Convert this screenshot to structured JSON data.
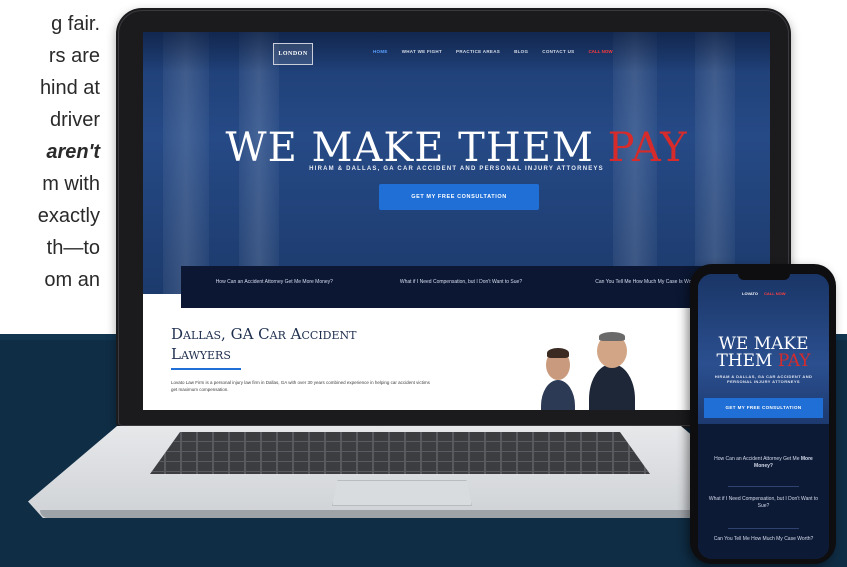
{
  "article": {
    "lines": [
      {
        "text": "g fair.",
        "emphasis": false
      },
      {
        "text": "rs are",
        "emphasis": false
      },
      {
        "text": "hind at",
        "emphasis": false
      },
      {
        "text": "driver",
        "emphasis": false
      },
      {
        "text": "aren't",
        "emphasis": true
      },
      {
        "text": "m with",
        "emphasis": false
      },
      {
        "text": "exactly",
        "emphasis": false
      },
      {
        "text": "th—to",
        "emphasis": false
      },
      {
        "text": "om an",
        "emphasis": false
      }
    ]
  },
  "laptop_site": {
    "logo_text": "LONDON",
    "nav": {
      "items": [
        "HOME",
        "WHAT WE FIGHT",
        "PRACTICE AREAS",
        "BLOG",
        "CONTACT US"
      ],
      "phone": "CALL NOW"
    },
    "headline_main": "WE MAKE THEM ",
    "headline_accent": "PAY",
    "subheadline": "HIRAM & DALLAS, GA CAR ACCIDENT AND PERSONAL INJURY ATTORNEYS",
    "cta_label": "GET MY FREE CONSULTATION",
    "questions": [
      "How Can an Accident Attorney Get Me More Money?",
      "What if I Need Compensation, but I Don't Want to Sue?",
      "Can You Tell Me How Much My Case Is Worth?"
    ],
    "section_title": "Dallas, GA Car Accident Lawyers",
    "section_text": "Lovato Law Firm is a personal injury law firm in Dallas, GA with over 30 years combined experience in helping car accident victims get maximum compensation."
  },
  "phone_site": {
    "logo_text": "LOVATO",
    "phone": "CALL NOW",
    "headline_line1": "WE MAKE",
    "headline_line2_main": "THEM ",
    "headline_line2_accent": "PAY",
    "subheadline": "HIRAM & DALLAS, GA CAR ACCIDENT AND PERSONAL INJURY ATTORNEYS",
    "cta_label": "GET MY FREE CONSULTATION",
    "questions": [
      {
        "text": "How Can an Accident Attorney Get Me ",
        "bold": "More Money?"
      },
      {
        "text": "What if I Need Compensation, but I Don't Want to Sue?",
        "bold": ""
      },
      {
        "text": "Can You Tell Me How Much My Case Worth?",
        "bold": ""
      }
    ]
  },
  "colors": {
    "band": "#0f2d45",
    "hero_blue": "#264a86",
    "accent_red": "#d72b2b",
    "cta_blue": "#1f6fd6"
  }
}
